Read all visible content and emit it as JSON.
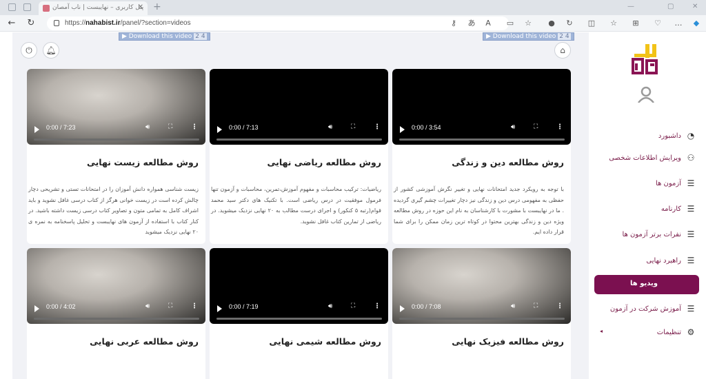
{
  "browser": {
    "tab_title": "پنل کاربری – نهایبست | ناب آمصان",
    "url_prefix": "https://",
    "url_domain": "nahabist.ir",
    "url_path": "/panel/?section=videos"
  },
  "page": {
    "download_banner": "▶ Download this video",
    "download_num": "2 4",
    "cards": [
      {
        "time": "0:00 / 3:54",
        "title": "روش مطالعه دین و زندگی",
        "desc": "با توجه به رویکرد جدید امتحانات نهایی و تغییر نگرش آموزشی کشور از حفظی به مفهومی درس دین و زندگی نیز دچار تغییرات چشم گیری گردیده . ما در نهایبست با مشورت با کارشناسان به نام این حوزه در روش مطالعه ویژه دین و زندگی بهترین محتوا در کوتاه ترین زمان ممکن را برای شما قرار داده ایم."
      },
      {
        "time": "0:00 / 7:13",
        "title": "روش مطالعه ریاضی نهایی",
        "desc": "ریاضیات: ترکیب محاسبات و مفهوم آموزش،تمرین، محاسبات و آزمون تنها فرمول موفقیت در درس ریاضی است. با تکنیک های دکتر سید محمد قوام(رتبه ۵ کنکور) و اجرای درست مطالب به ۲۰ نهایی نزدیک میشوید. در ریاضی از تمارین کتاب غافل نشوید."
      },
      {
        "time": "0:00 / 7:23",
        "title": "روش مطالعه زیست نهایی",
        "desc": "زیست شناسی همواره دانش آموزان را در امتحانات تستی و تشریحی دچار چالش کرده است در زیست خوانی هرگز از کتاب درسی غافل نشوید و باید اشراف کامل به تمامی متون و تصاویر کتاب درسی زیست داشته باشید. در کنار کتاب با استفاده از آزمون های نهایبست و تحلیل پاسخنامه به نمره ی ۲۰ نهایی نزدیک میشوید"
      },
      {
        "time": "0:00 / 7:08",
        "title": "روش مطالعه فیزیک نهایی",
        "desc": ""
      },
      {
        "time": "0:00 / 7:19",
        "title": "روش مطالعه شیمی نهایی",
        "desc": ""
      },
      {
        "time": "0:00 / 4:02",
        "title": "روش مطالعه عربی نهایی",
        "desc": ""
      }
    ]
  },
  "sidebar": {
    "logo_text": "نها یبست",
    "items": [
      {
        "label": "داشبورد",
        "icon": "dashboard-icon"
      },
      {
        "label": "ویرایش اطلاعات شخصی",
        "icon": "user-icon"
      },
      {
        "label": "آزمون ها",
        "icon": "list-icon"
      },
      {
        "label": "کارنامه",
        "icon": "list-icon"
      },
      {
        "label": "نفرات برتر آزمون ها",
        "icon": "list-icon"
      },
      {
        "label": "راهبرد نهایی",
        "icon": "list-icon"
      },
      {
        "label": "ویدیو ها",
        "icon": "",
        "active": true
      },
      {
        "label": "آموزش شرکت در آزمون",
        "icon": "list-icon"
      },
      {
        "label": "تنظیمات",
        "icon": "gear-icon"
      }
    ]
  },
  "colors": {
    "brand": "#7b1050",
    "content_bg": "#f1f2f6"
  }
}
